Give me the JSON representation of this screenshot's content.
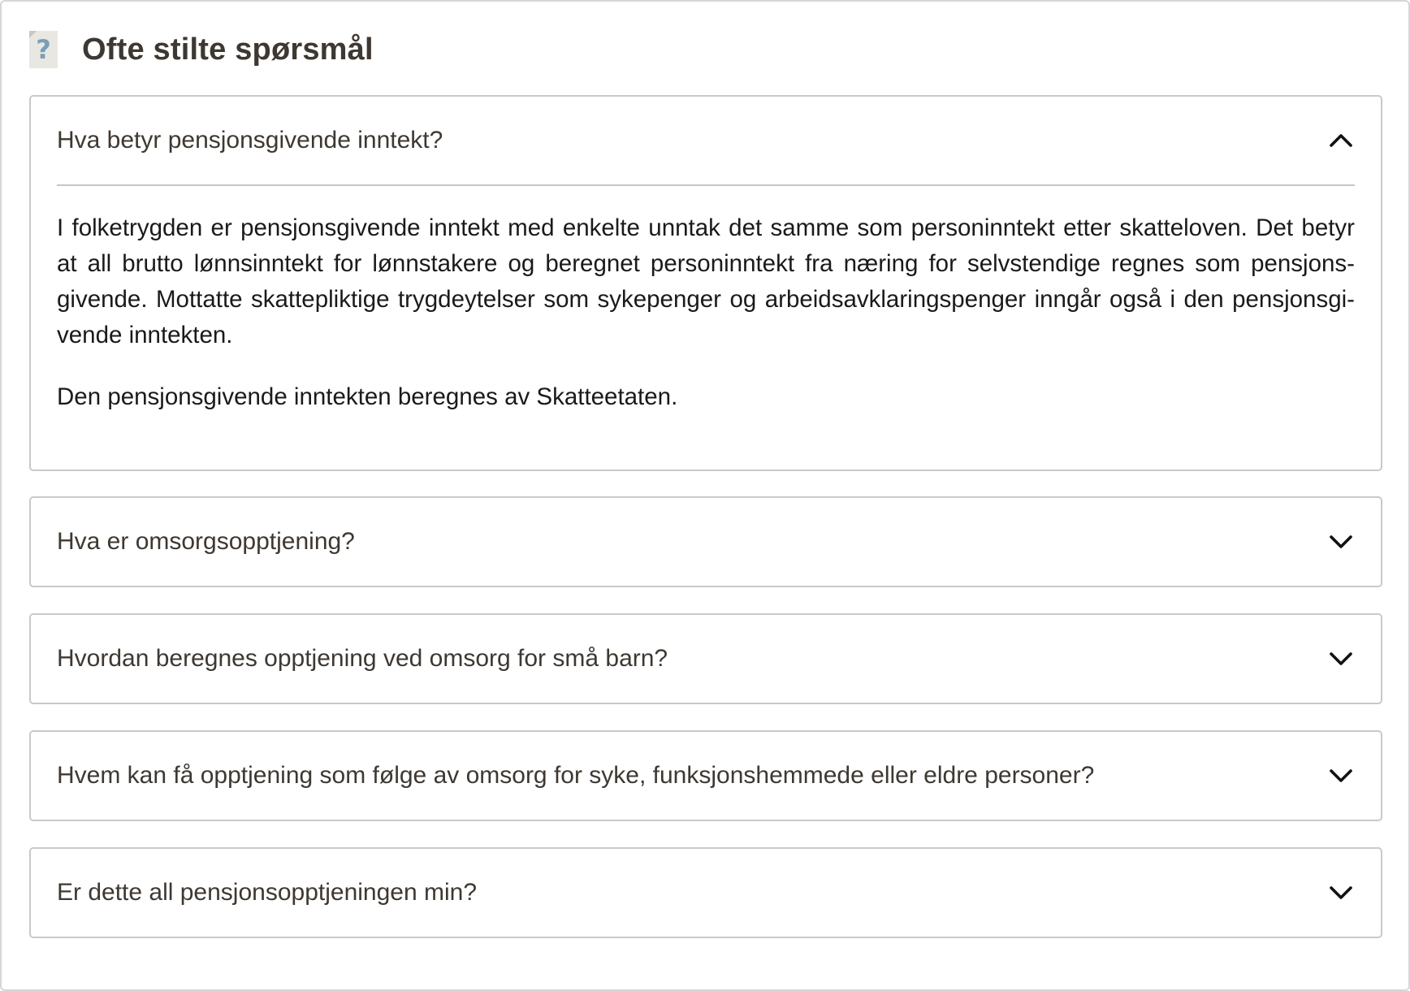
{
  "section": {
    "title": "Ofte stilte spørsmål",
    "icon": "question-mark-icon",
    "icon_glyph": "?"
  },
  "faq": [
    {
      "question": "Hva betyr pensjonsgivende inntekt?",
      "expanded": true,
      "answer": [
        "I folketrygden er pensjonsgivende inntekt med enkelte unntak det samme som personinntekt etter skatteloven. Det be­tyr at all brutto lønnsinntekt for lønnstakere og beregnet personinntekt fra næring for selvstendige regnes som pensjons­givende. Mottatte skattepliktige trygdeytelser som sykepenger og arbeidsavklaringspenger inngår også i den pensjonsgi­vende inntekten.",
        "Den pensjonsgivende inntekten beregnes av Skatteetaten."
      ]
    },
    {
      "question": "Hva er omsorgsopptjening?",
      "expanded": false
    },
    {
      "question": "Hvordan beregnes opptjening ved omsorg for små barn?",
      "expanded": false
    },
    {
      "question": "Hvem kan få opptjening som følge av omsorg for syke, funksjonshemmede eller eldre personer?",
      "expanded": false
    },
    {
      "question": "Er dette all pensjonsopptjeningen min?",
      "expanded": false
    }
  ]
}
